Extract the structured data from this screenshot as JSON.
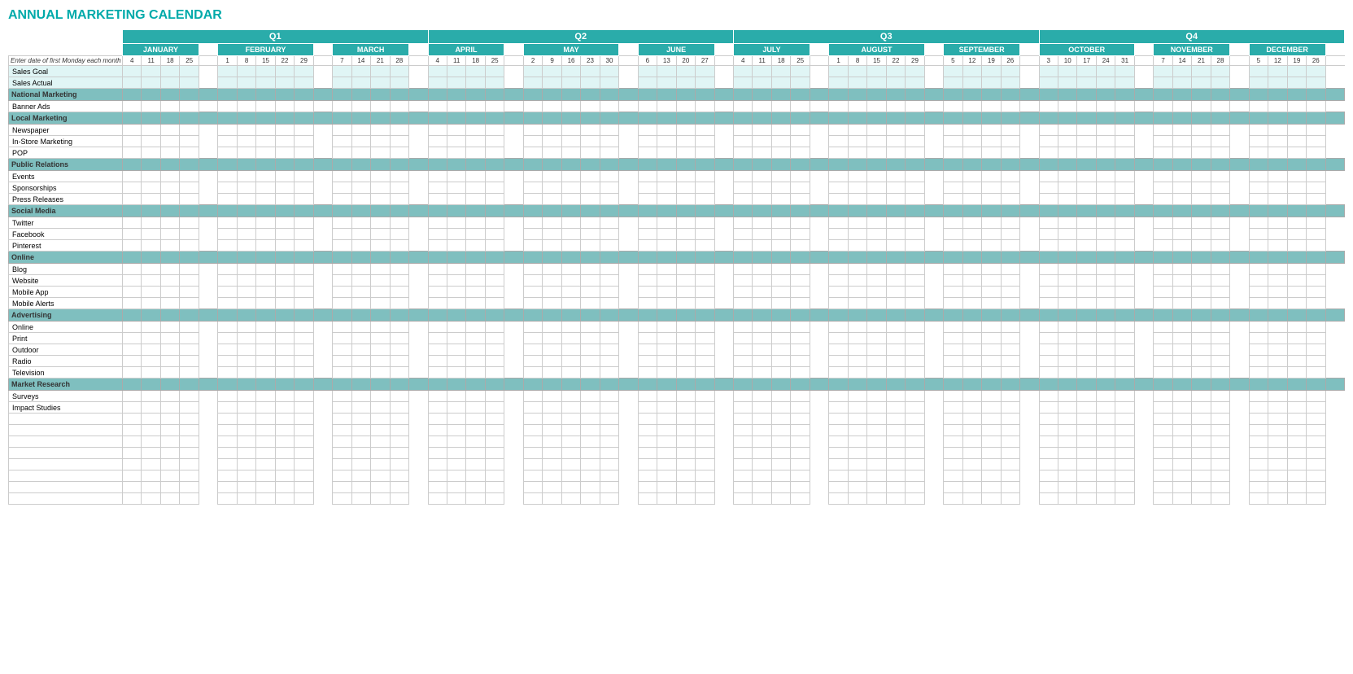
{
  "title": "ANNUAL MARKETING CALENDAR",
  "quarters": [
    {
      "label": "Q1",
      "span": 14
    },
    {
      "label": "Q2",
      "span": 14
    },
    {
      "label": "Q3",
      "span": 14
    },
    {
      "label": "Q4",
      "span": 14
    }
  ],
  "months": [
    {
      "label": "JANUARY",
      "days": [
        "4",
        "11",
        "18",
        "25"
      ],
      "q": 1
    },
    {
      "label": "FEBRUARY",
      "days": [
        "1",
        "8",
        "15",
        "22",
        "29"
      ],
      "q": 1
    },
    {
      "label": "MARCH",
      "days": [
        "7",
        "14",
        "21",
        "28"
      ],
      "q": 1
    },
    {
      "label": "APRIL",
      "days": [
        "4",
        "11",
        "18",
        "25"
      ],
      "q": 2
    },
    {
      "label": "MAY",
      "days": [
        "2",
        "9",
        "16",
        "23",
        "30"
      ],
      "q": 2
    },
    {
      "label": "JUNE",
      "days": [
        "6",
        "13",
        "20",
        "27"
      ],
      "q": 2
    },
    {
      "label": "JULY",
      "days": [
        "4",
        "11",
        "18",
        "25"
      ],
      "q": 3
    },
    {
      "label": "AUGUST",
      "days": [
        "1",
        "8",
        "15",
        "22",
        "29"
      ],
      "q": 3
    },
    {
      "label": "SEPTEMBER",
      "days": [
        "5",
        "12",
        "19",
        "26"
      ],
      "q": 3
    },
    {
      "label": "OCTOBER",
      "days": [
        "3",
        "10",
        "17",
        "24",
        "31"
      ],
      "q": 4
    },
    {
      "label": "NOVEMBER",
      "days": [
        "7",
        "14",
        "21",
        "28"
      ],
      "q": 4
    },
    {
      "label": "DECEMBER",
      "days": [
        "5",
        "12",
        "19",
        "26"
      ],
      "q": 4
    }
  ],
  "instruction_label": "Enter date of first Monday each month",
  "sections": [
    {
      "name": "Sales Goal",
      "type": "sales"
    },
    {
      "name": "Sales Actual",
      "type": "sales"
    },
    {
      "name": "National Marketing",
      "type": "section"
    },
    {
      "name": "Banner Ads",
      "type": "data"
    },
    {
      "name": "Local Marketing",
      "type": "section"
    },
    {
      "name": "Newspaper",
      "type": "data"
    },
    {
      "name": "In-Store Marketing",
      "type": "data"
    },
    {
      "name": "POP",
      "type": "data"
    },
    {
      "name": "Public Relations",
      "type": "section"
    },
    {
      "name": "Events",
      "type": "data"
    },
    {
      "name": "Sponsorships",
      "type": "data"
    },
    {
      "name": "Press Releases",
      "type": "data"
    },
    {
      "name": "Social Media",
      "type": "section"
    },
    {
      "name": "Twitter",
      "type": "data"
    },
    {
      "name": "Facebook",
      "type": "data"
    },
    {
      "name": "Pinterest",
      "type": "data"
    },
    {
      "name": "Online",
      "type": "section"
    },
    {
      "name": "Blog",
      "type": "data"
    },
    {
      "name": "Website",
      "type": "data"
    },
    {
      "name": "Mobile App",
      "type": "data"
    },
    {
      "name": "Mobile Alerts",
      "type": "data"
    },
    {
      "name": "Advertising",
      "type": "section"
    },
    {
      "name": "Online",
      "type": "data"
    },
    {
      "name": "Print",
      "type": "data"
    },
    {
      "name": "Outdoor",
      "type": "data"
    },
    {
      "name": "Radio",
      "type": "data"
    },
    {
      "name": "Television",
      "type": "data"
    },
    {
      "name": "Market Research",
      "type": "section"
    },
    {
      "name": "Surveys",
      "type": "data"
    },
    {
      "name": "Impact Studies",
      "type": "data"
    },
    {
      "name": "",
      "type": "empty"
    },
    {
      "name": "",
      "type": "empty"
    },
    {
      "name": "",
      "type": "empty"
    },
    {
      "name": "",
      "type": "empty"
    },
    {
      "name": "",
      "type": "empty"
    },
    {
      "name": "",
      "type": "empty"
    },
    {
      "name": "",
      "type": "empty"
    },
    {
      "name": "",
      "type": "empty"
    }
  ]
}
